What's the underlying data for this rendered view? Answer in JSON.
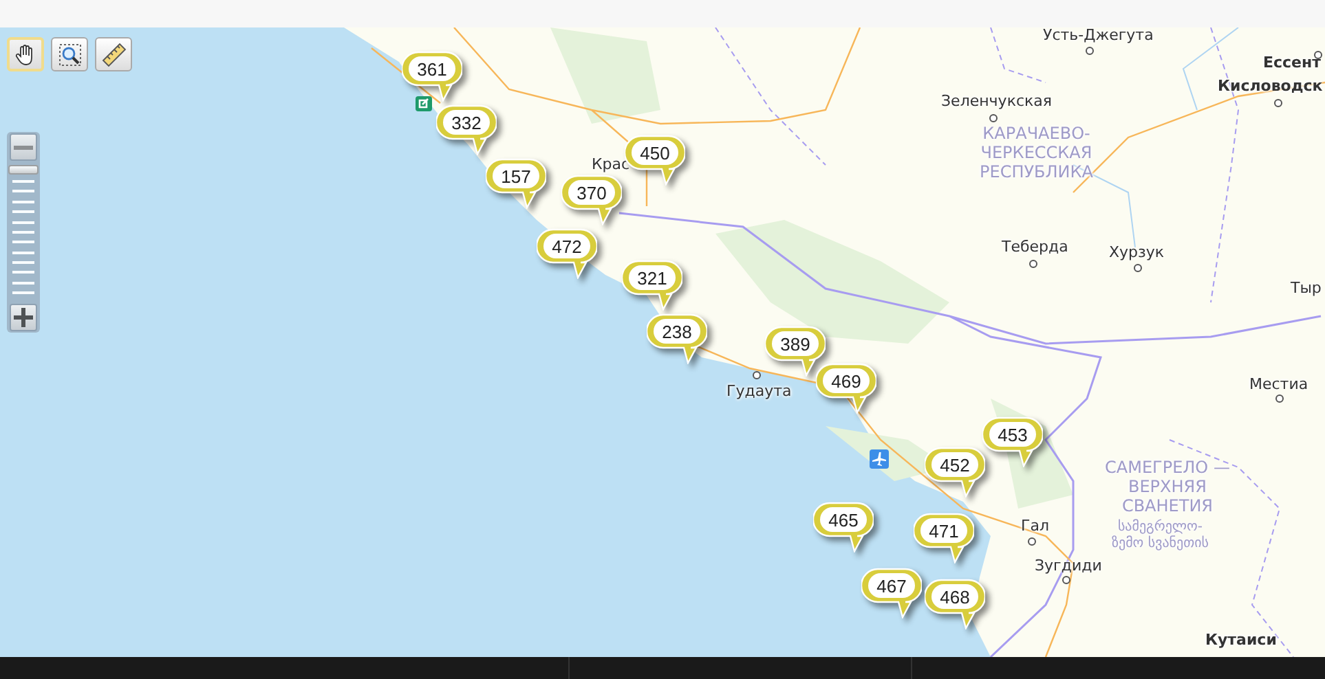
{
  "toolbar": [
    {
      "kind": "hand",
      "selected": true
    },
    {
      "kind": "zoom-box",
      "selected": false
    },
    {
      "kind": "ruler",
      "selected": false
    }
  ],
  "zoom": {
    "level": 0.03
  },
  "places": [
    {
      "kind": "town",
      "lines": [
        "Усть-Джегута"
      ]
    },
    {
      "kind": "town",
      "lines": [
        "Зеленчукская"
      ]
    },
    {
      "kind": "region",
      "lines": [
        "КАРАЧАЕВО-",
        "ЧЕРКЕССКАЯ",
        "РЕСПУБЛИКА"
      ]
    },
    {
      "kind": "city",
      "lines": [
        "Ессент"
      ]
    },
    {
      "kind": "city",
      "lines": [
        "Кисловодск"
      ]
    },
    {
      "kind": "town",
      "lines": [
        "Крас"
      ]
    },
    {
      "kind": "town",
      "lines": [
        "Теберда"
      ]
    },
    {
      "kind": "town",
      "lines": [
        "Хурзук"
      ]
    },
    {
      "kind": "town",
      "lines": [
        "Тыр"
      ]
    },
    {
      "kind": "town",
      "lines": [
        "Гудаута"
      ]
    },
    {
      "kind": "town",
      "lines": [
        "Местиа"
      ]
    },
    {
      "kind": "region",
      "lines": [
        "САМЕГРЕЛО —",
        "ВЕРХНЯЯ",
        "СВАНЕТИЯ"
      ]
    },
    {
      "kind": "town",
      "lines": [
        "Гал"
      ]
    },
    {
      "kind": "region-local",
      "lines": [
        "სამეგრელო-",
        "ზემო სვანეთის"
      ]
    },
    {
      "kind": "town",
      "lines": [
        "Зугдиди"
      ]
    },
    {
      "kind": "city",
      "lines": [
        "Кутаиси"
      ]
    }
  ],
  "markers": [
    {
      "label": "361"
    },
    {
      "label": "332"
    },
    {
      "label": "157"
    },
    {
      "label": "450"
    },
    {
      "label": "370"
    },
    {
      "label": "472"
    },
    {
      "label": "321"
    },
    {
      "label": "238"
    },
    {
      "label": "389"
    },
    {
      "label": "469"
    },
    {
      "label": "453"
    },
    {
      "label": "452"
    },
    {
      "label": "465"
    },
    {
      "label": "471"
    },
    {
      "label": "467"
    },
    {
      "label": "468"
    }
  ]
}
